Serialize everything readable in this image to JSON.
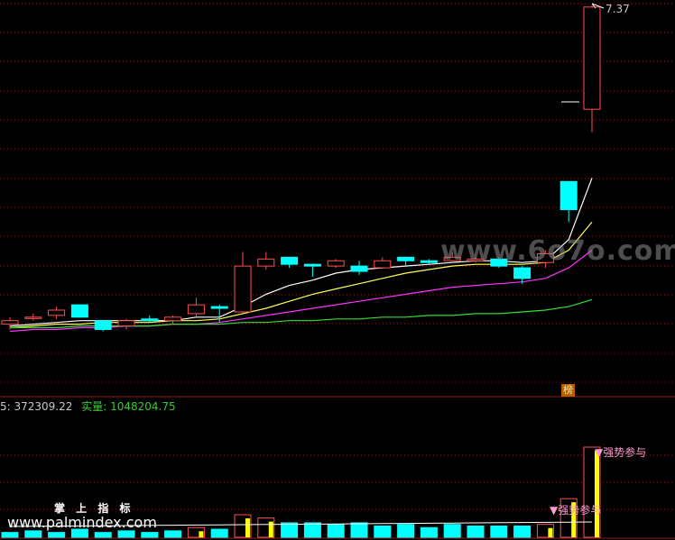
{
  "app": {
    "high_price_label": "7.37",
    "volume_label": "5: 372309.22",
    "real_volume_label": "实量:",
    "real_volume_value": "1048204.75",
    "marker_bang": "榜",
    "signal_label_top": "▼强势参与",
    "signal_label_low": "▼强势参与",
    "logo_cn": "掌 上 指 标",
    "logo_url": "www.palmindex.com",
    "watermark": "www.6o7o.com"
  },
  "colors": {
    "background": "#000000",
    "grid": "#8b1a1a",
    "up_candle": "#ff5050",
    "down_candle": "#00ffff",
    "ma_white": "#ffffff",
    "ma_yellow": "#ffff55",
    "ma_magenta": "#ff33ff",
    "ma_green": "#33dd33",
    "vol_yellow": "#ffff00"
  },
  "chart_data": {
    "type": "candlestick",
    "price_range": [
      5.2,
      7.4
    ],
    "candles": [
      {
        "o": 5.56,
        "h": 5.6,
        "l": 5.53,
        "c": 5.58
      },
      {
        "o": 5.6,
        "h": 5.62,
        "l": 5.58,
        "c": 5.6
      },
      {
        "o": 5.61,
        "h": 5.66,
        "l": 5.59,
        "c": 5.64
      },
      {
        "o": 5.67,
        "h": 5.67,
        "l": 5.6,
        "c": 5.6
      },
      {
        "o": 5.58,
        "h": 5.58,
        "l": 5.52,
        "c": 5.53
      },
      {
        "o": 5.55,
        "h": 5.59,
        "l": 5.53,
        "c": 5.58
      },
      {
        "o": 5.59,
        "h": 5.61,
        "l": 5.57,
        "c": 5.58
      },
      {
        "o": 5.58,
        "h": 5.61,
        "l": 5.56,
        "c": 5.6
      },
      {
        "o": 5.62,
        "h": 5.71,
        "l": 5.6,
        "c": 5.67
      },
      {
        "o": 5.66,
        "h": 5.67,
        "l": 5.57,
        "c": 5.65
      },
      {
        "o": 5.63,
        "h": 5.97,
        "l": 5.62,
        "c": 5.89
      },
      {
        "o": 5.89,
        "h": 5.97,
        "l": 5.87,
        "c": 5.93
      },
      {
        "o": 5.94,
        "h": 5.94,
        "l": 5.88,
        "c": 5.9
      },
      {
        "o": 5.9,
        "h": 5.9,
        "l": 5.83,
        "c": 5.89
      },
      {
        "o": 5.89,
        "h": 5.93,
        "l": 5.88,
        "c": 5.92
      },
      {
        "o": 5.89,
        "h": 5.92,
        "l": 5.84,
        "c": 5.86
      },
      {
        "o": 5.88,
        "h": 5.94,
        "l": 5.88,
        "c": 5.92
      },
      {
        "o": 5.94,
        "h": 5.94,
        "l": 5.89,
        "c": 5.92
      },
      {
        "o": 5.92,
        "h": 5.93,
        "l": 5.9,
        "c": 5.91
      },
      {
        "o": 5.92,
        "h": 5.97,
        "l": 5.91,
        "c": 5.94
      },
      {
        "o": 5.92,
        "h": 5.94,
        "l": 5.91,
        "c": 5.93
      },
      {
        "o": 5.93,
        "h": 5.94,
        "l": 5.88,
        "c": 5.89
      },
      {
        "o": 5.88,
        "h": 5.89,
        "l": 5.79,
        "c": 5.82
      },
      {
        "o": 5.91,
        "h": 5.98,
        "l": 5.88,
        "c": 5.96
      },
      {
        "o": 6.37,
        "h": 6.37,
        "l": 6.14,
        "c": 6.21
      },
      {
        "o": 6.78,
        "h": 7.37,
        "l": 6.65,
        "c": 7.36
      }
    ],
    "ma_series": [
      {
        "color": "#ffffff",
        "values": [
          5.55,
          5.56,
          5.57,
          5.58,
          5.58,
          5.58,
          5.58,
          5.58,
          5.6,
          5.6,
          5.66,
          5.73,
          5.78,
          5.81,
          5.85,
          5.87,
          5.88,
          5.89,
          5.9,
          5.91,
          5.92,
          5.92,
          5.91,
          5.92,
          6.04,
          6.39
        ]
      },
      {
        "color": "#ffff55",
        "values": [
          5.54,
          5.55,
          5.56,
          5.56,
          5.57,
          5.57,
          5.57,
          5.58,
          5.58,
          5.59,
          5.62,
          5.65,
          5.69,
          5.73,
          5.76,
          5.79,
          5.82,
          5.85,
          5.87,
          5.89,
          5.9,
          5.9,
          5.9,
          5.91,
          5.98,
          6.14
        ]
      },
      {
        "color": "#ff33ff",
        "values": [
          5.52,
          5.53,
          5.53,
          5.54,
          5.54,
          5.55,
          5.55,
          5.56,
          5.56,
          5.57,
          5.59,
          5.61,
          5.63,
          5.65,
          5.67,
          5.69,
          5.71,
          5.73,
          5.75,
          5.77,
          5.78,
          5.79,
          5.8,
          5.82,
          5.88,
          5.98
        ]
      },
      {
        "color": "#33dd33",
        "values": [
          5.54,
          5.54,
          5.54,
          5.55,
          5.55,
          5.55,
          5.55,
          5.56,
          5.56,
          5.56,
          5.57,
          5.57,
          5.58,
          5.58,
          5.59,
          5.59,
          5.6,
          5.6,
          5.61,
          5.61,
          5.62,
          5.62,
          5.63,
          5.64,
          5.66,
          5.7
        ]
      }
    ],
    "volume": {
      "values": [
        3,
        4,
        3,
        5,
        3,
        4,
        3,
        4,
        6,
        5,
        14,
        12,
        9,
        9,
        8,
        9,
        7,
        8,
        6,
        8,
        7,
        7,
        7,
        8,
        24,
        56
      ],
      "highlight": [
        false,
        false,
        false,
        false,
        false,
        false,
        false,
        false,
        true,
        false,
        true,
        true,
        false,
        false,
        false,
        false,
        false,
        false,
        false,
        false,
        false,
        false,
        false,
        true,
        true,
        true
      ]
    }
  }
}
